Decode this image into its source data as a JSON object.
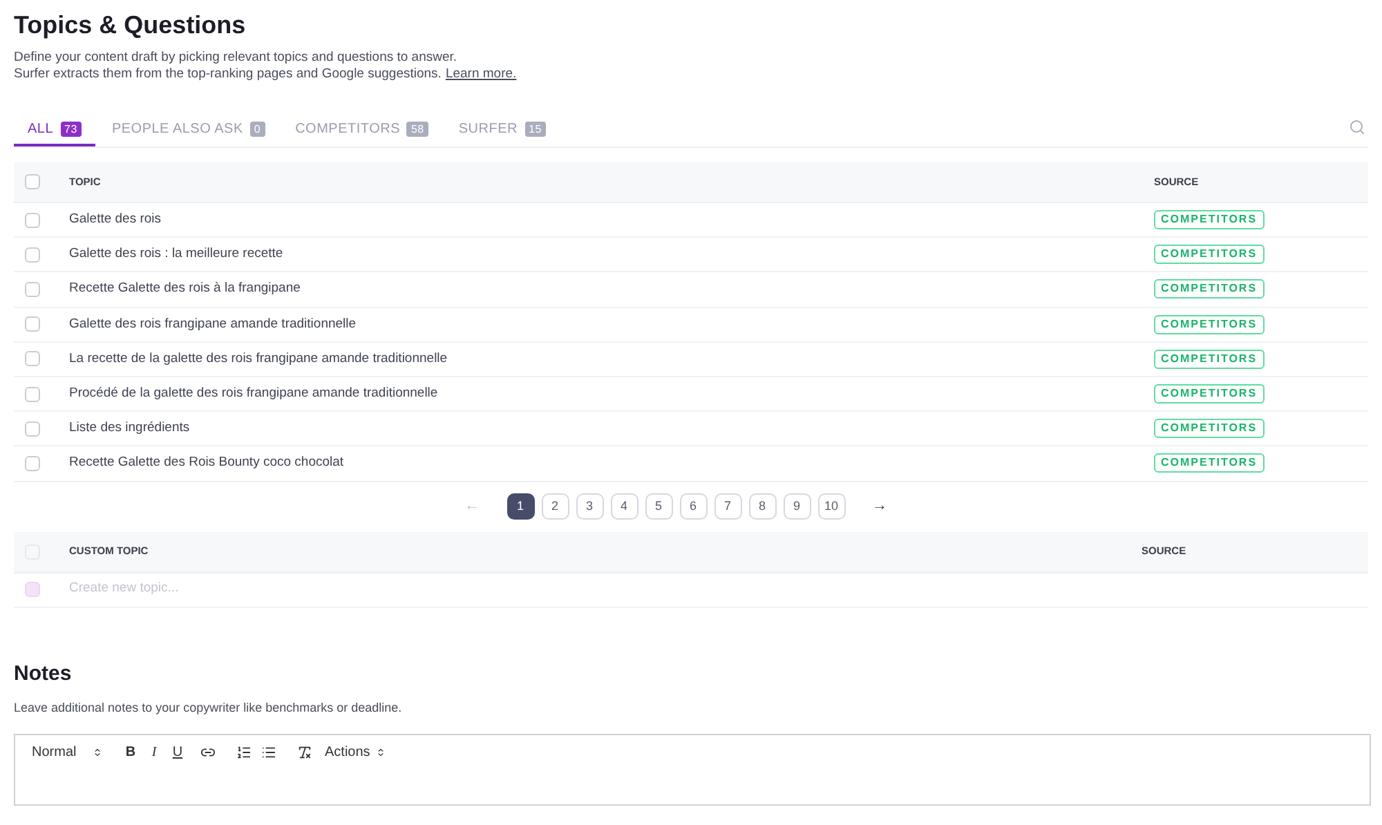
{
  "header": {
    "title": "Topics & Questions",
    "description_lines": [
      "Define your content draft by picking relevant topics and questions to answer.",
      "Surfer extracts them from the top-ranking pages and Google suggestions."
    ],
    "link": "Learn more."
  },
  "tabs": [
    {
      "label": "ALL",
      "count": "73",
      "selected": true
    },
    {
      "label": "PEOPLE ALSO ASK",
      "count": "0",
      "selected": false
    },
    {
      "label": "COMPETITORS",
      "count": "58",
      "selected": false
    },
    {
      "label": "SURFER",
      "count": "15",
      "selected": false
    }
  ],
  "table": {
    "columns": [
      "TOPIC",
      "SOURCE"
    ],
    "header_checked": false,
    "rows": [
      {
        "topic": "Galette des rois",
        "source": "COMPETITORS",
        "checked": false
      },
      {
        "topic": "Galette des rois : la meilleure recette",
        "source": "COMPETITORS",
        "checked": false
      },
      {
        "topic": "Recette Galette des rois à la frangipane",
        "source": "COMPETITORS",
        "checked": false
      },
      {
        "topic": "Galette des rois frangipane amande traditionnelle",
        "source": "COMPETITORS",
        "checked": false
      },
      {
        "topic": "La recette de la galette des rois frangipane amande traditionnelle",
        "source": "COMPETITORS",
        "checked": false
      },
      {
        "topic": "Procédé de la galette des rois frangipane amande traditionnelle",
        "source": "COMPETITORS",
        "checked": false
      },
      {
        "topic": "Liste des ingrédients",
        "source": "COMPETITORS",
        "checked": false
      },
      {
        "topic": "Recette Galette des Rois Bounty coco chocolat",
        "source": "COMPETITORS",
        "checked": false
      }
    ]
  },
  "pagination": {
    "prev": {
      "label": "←",
      "disabled": true
    },
    "next": {
      "label": "→",
      "disabled": false
    },
    "pages": [
      {
        "label": "1",
        "selected": true
      },
      {
        "label": "2",
        "selected": false
      },
      {
        "label": "3",
        "selected": false
      },
      {
        "label": "4",
        "selected": false
      },
      {
        "label": "5",
        "selected": false
      },
      {
        "label": "6",
        "selected": false
      },
      {
        "label": "7",
        "selected": false
      },
      {
        "label": "8",
        "selected": false
      },
      {
        "label": "9",
        "selected": false
      },
      {
        "label": "10",
        "selected": false
      }
    ]
  },
  "custom_table": {
    "columns": [
      "CUSTOM TOPIC",
      "SOURCE"
    ],
    "header_checked": false,
    "new_row_disabled": true,
    "placeholder": "Create new topic..."
  },
  "notes": {
    "title": "Notes",
    "description": "Leave additional notes to your copywriter like benchmarks or deadline.",
    "toolbar": [
      {
        "kind": "select",
        "label": "Normal"
      },
      {
        "kind": "bold",
        "label": "B"
      },
      {
        "kind": "italic",
        "label": "I"
      },
      {
        "kind": "underline",
        "label": "U"
      },
      {
        "kind": "link"
      },
      {
        "kind": "numbered"
      },
      {
        "kind": "bulleted"
      },
      {
        "kind": "clear"
      },
      {
        "kind": "select",
        "label": "Actions"
      }
    ]
  }
}
